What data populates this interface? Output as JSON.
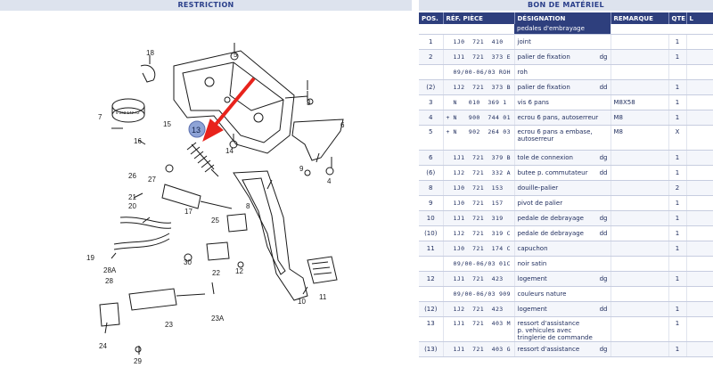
{
  "headers": {
    "left": "RESTRICTION",
    "right": "BON DE MATÉRIEL"
  },
  "table": {
    "columns": [
      "POS.",
      "RÉF. PIÈCE",
      "DÉSIGNATION",
      "REMARQUE",
      "QTE",
      "L"
    ],
    "section_title": "pedales d'embrayage",
    "rows": [
      {
        "pos": "1",
        "plus": "",
        "ref": "1J0  721  410",
        "suffix": "",
        "des": "joint",
        "side": "",
        "rem": "",
        "qte": "1",
        "l": ""
      },
      {
        "pos": "2",
        "plus": "",
        "ref": "1J1  721  373",
        "suffix": "E",
        "des": "palier de fixation",
        "side": "dg",
        "rem": "",
        "qte": "1",
        "l": ""
      },
      {
        "pos": "",
        "plus": "",
        "ref": "09/00-06/03",
        "suffix": "ROH",
        "des": "roh",
        "side": "",
        "rem": "",
        "qte": "",
        "l": ""
      },
      {
        "pos": "(2)",
        "plus": "",
        "ref": "1J2  721  373",
        "suffix": "B",
        "des": "palier de fixation",
        "side": "dd",
        "rem": "",
        "qte": "1",
        "l": ""
      },
      {
        "pos": "3",
        "plus": "",
        "ref": "N   010  369",
        "suffix": "1",
        "des": "vis 6 pans",
        "side": "",
        "rem": "M8X58",
        "qte": "1",
        "l": ""
      },
      {
        "pos": "4",
        "plus": "+",
        "ref": "N   900  744",
        "suffix": "01",
        "des": "ecrou 6 pans, autoserreur",
        "side": "",
        "rem": "M8",
        "qte": "1",
        "l": ""
      },
      {
        "pos": "5",
        "plus": "+",
        "ref": "N   902  264",
        "suffix": "03",
        "des": "ecrou 6 pans a embase,\nautoserreur",
        "side": "",
        "rem": "M8",
        "qte": "X",
        "l": ""
      },
      {
        "pos": "6",
        "plus": "",
        "ref": "1J1  721  379",
        "suffix": "B",
        "des": "tole de connexion",
        "side": "dg",
        "rem": "",
        "qte": "1",
        "l": ""
      },
      {
        "pos": "(6)",
        "plus": "",
        "ref": "1J2  721  332",
        "suffix": "A",
        "des": "butee p. commutateur",
        "side": "dd",
        "rem": "",
        "qte": "1",
        "l": ""
      },
      {
        "pos": "8",
        "plus": "",
        "ref": "1J0  721  153",
        "suffix": "",
        "des": "douille-palier",
        "side": "",
        "rem": "",
        "qte": "2",
        "l": ""
      },
      {
        "pos": "9",
        "plus": "",
        "ref": "1J0  721  157",
        "suffix": "",
        "des": "pivot de palier",
        "side": "",
        "rem": "",
        "qte": "1",
        "l": ""
      },
      {
        "pos": "10",
        "plus": "",
        "ref": "1J1  721  319",
        "suffix": "",
        "des": "pedale de debrayage",
        "side": "dg",
        "rem": "",
        "qte": "1",
        "l": ""
      },
      {
        "pos": "(10)",
        "plus": "",
        "ref": "1J2  721  319",
        "suffix": "C",
        "des": "pedale de debrayage",
        "side": "dd",
        "rem": "",
        "qte": "1",
        "l": ""
      },
      {
        "pos": "11",
        "plus": "",
        "ref": "1J0  721  174",
        "suffix": "C",
        "des": "capuchon",
        "side": "",
        "rem": "",
        "qte": "1",
        "l": ""
      },
      {
        "pos": "",
        "plus": "",
        "ref": "09/00-06/03",
        "suffix": "01C",
        "des": "noir satin",
        "side": "",
        "rem": "",
        "qte": "",
        "l": ""
      },
      {
        "pos": "12",
        "plus": "",
        "ref": "1J1  721  423",
        "suffix": "",
        "des": "logement",
        "side": "dg",
        "rem": "",
        "qte": "1",
        "l": ""
      },
      {
        "pos": "",
        "plus": "",
        "ref": "09/00-06/03",
        "suffix": "909",
        "des": "couleurs nature",
        "side": "",
        "rem": "",
        "qte": "",
        "l": ""
      },
      {
        "pos": "(12)",
        "plus": "",
        "ref": "1J2  721  423",
        "suffix": "",
        "des": "logement",
        "side": "dd",
        "rem": "",
        "qte": "1",
        "l": ""
      },
      {
        "pos": "13",
        "plus": "",
        "ref": "1J1  721  403",
        "suffix": "M",
        "des": "ressort d'assistance\np. vehicules avec\ntringlerie de commande",
        "side": "",
        "rem": "",
        "qte": "1",
        "l": ""
      },
      {
        "pos": "(13)",
        "plus": "",
        "ref": "1J1  721  403",
        "suffix": "G",
        "des": "ressort d'assistance",
        "side": "dg",
        "rem": "",
        "qte": "1",
        "l": ""
      }
    ]
  },
  "diagram": {
    "callouts": [
      "1",
      "2",
      "3",
      "4",
      "5",
      "6",
      "7",
      "8",
      "9",
      "10",
      "11",
      "12",
      "13",
      "14",
      "15",
      "16",
      "17",
      "18",
      "19",
      "20",
      "21",
      "22",
      "23",
      "23A",
      "24",
      "25",
      "26",
      "27",
      "28",
      "28A",
      "29",
      "30"
    ],
    "stamp_text": "6 262 142 A2",
    "highlighted_callout": "13",
    "colors": {
      "line": "#1a1a1a",
      "arrow": "#e8231c",
      "badge": "#8ea3d6"
    }
  }
}
